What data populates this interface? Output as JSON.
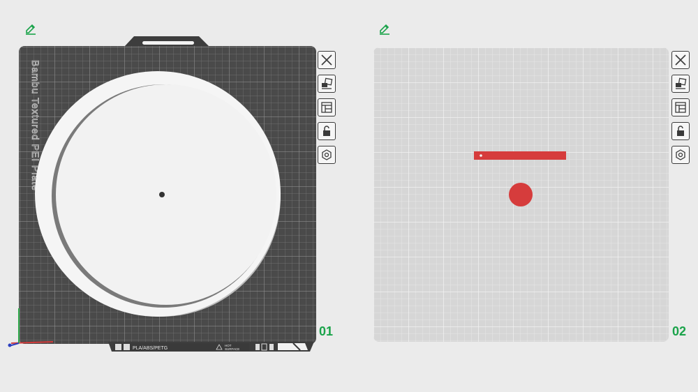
{
  "plates": [
    {
      "id": "plate-1",
      "number": "01",
      "bed_label": "Bambu Textured PEI Plate",
      "footer_material": "PLA/ABS/PETG",
      "footer_surface_line1": "HOT",
      "footer_surface_line2": "SURFACE",
      "theme": "dark",
      "colors": {
        "bed": "#4a4a4a",
        "grid": "#7a7a7a",
        "object": "#f5f5f5"
      }
    },
    {
      "id": "plate-2",
      "number": "02",
      "theme": "light",
      "colors": {
        "bed": "#d8d8d8",
        "grid": "#efefef",
        "object": "#d63c3c"
      }
    }
  ],
  "toolbar_icons": [
    "close-icon",
    "arrange-icon",
    "layout-icon",
    "lock-icon",
    "settings-icon"
  ],
  "colors": {
    "accent_green": "#1aa34a",
    "background": "#ebebeb",
    "icon_stroke": "#3a3a3a"
  }
}
